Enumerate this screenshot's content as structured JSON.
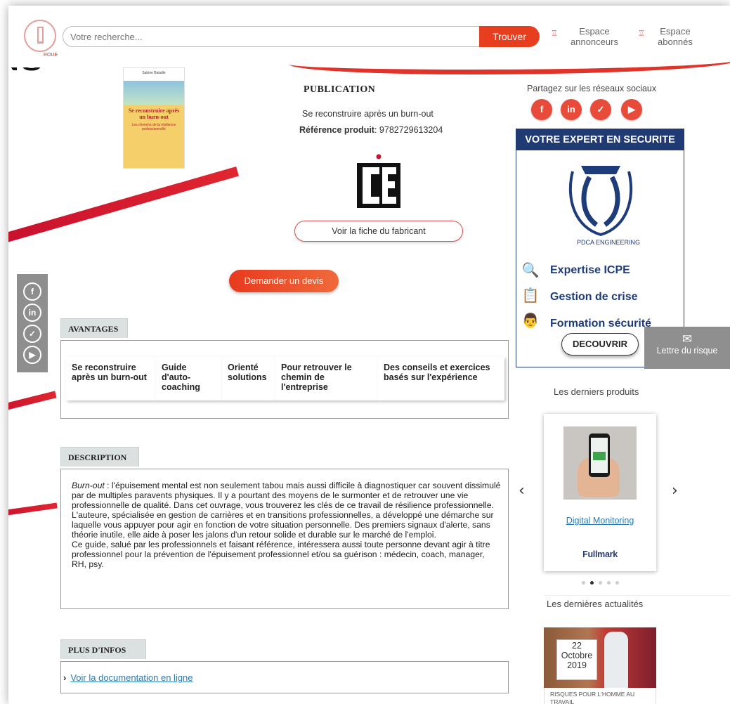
{
  "header": {
    "search_placeholder": "Votre recherche...",
    "search_button": "Trouver",
    "annonceurs_line1": "Espace",
    "annonceurs_line2": "annonceurs",
    "abonnes_line1": "Espace",
    "abonnes_line2": "abonnés",
    "logo_text": "ROUE",
    "background_text": "NS"
  },
  "publication": {
    "section_title": "PUBLICATION",
    "name": "Se reconstruire après un burn-out",
    "ref_label": "Référence produit",
    "ref_value": ": 9782729613204",
    "fiche_button": "Voir la fiche du fabricant",
    "devis_button": "Demander un devis",
    "book": {
      "author": "Sabine Bataille",
      "title": "Se reconstruire après un burn-out",
      "subtitle": "Les chemins de la résilience professionnelle"
    }
  },
  "avantages": {
    "label": "AVANTAGES",
    "items": [
      "Se reconstruire après un burn-out",
      "Guide d'auto-coaching",
      "Orienté solutions",
      "Pour retrouver le chemin de l'entreprise",
      "Des conseils et exercices basés sur l'expérience"
    ]
  },
  "description": {
    "label": "DESCRIPTION",
    "para1_em": "Burn-out",
    "para1": " : l'épuisement mental est non seulement tabou mais aussi difficile à diagnostiquer car souvent dissimulé par de multiples paravents physiques. Il y a pourtant des moyens de le surmonter et de retrouver une vie professionnelle de qualité. Dans cet ouvrage, vous trouverez les clés de ce travail de résilience professionnelle.",
    "para2": "L'auteure, spécialisée en gestion de carrières et en transitions professionnelles, a développé une démarche sur laquelle vous appuyer pour agir en fonction de votre situation personnelle. Des premiers signaux d'alerte, sans théorie inutile, elle aide à poser les jalons d'un retour solide et durable sur le marché de l'emploi.",
    "para3": "Ce guide, salué par les professionnels et faisant référence, intéressera aussi toute personne devant agir à titre professionnel pour la prévention de l'épuisement professionnel et/ou sa guérison : médecin, coach, manager, RH, psy."
  },
  "plus_infos": {
    "label": "PLUS D'INFOS",
    "link": "Voir la documentation en ligne"
  },
  "share": {
    "title": "Partagez sur les réseaux sociaux",
    "icons": [
      "facebook-icon",
      "linkedin-icon",
      "twitter-icon",
      "youtube-icon"
    ]
  },
  "ad": {
    "header": "VOTRE EXPERT EN SECURITE",
    "logo_text": "PDCA ENGINEERING",
    "items": [
      "Expertise ICPE",
      "Gestion de crise",
      "Formation sécurité"
    ],
    "button": "DECOUVRIR"
  },
  "newsletter": {
    "label": "Lettre du risque"
  },
  "products": {
    "title": "Les derniers produits",
    "items": [
      {
        "name": "Digital Monitoring",
        "brand": "Fullmark"
      }
    ],
    "dots": 5,
    "active_dot": 1
  },
  "news": {
    "title": "Les dernières actualités",
    "day": "22",
    "month": "Octobre",
    "year": "2019",
    "caption": "RISQUES POUR L'HOMME AU TRAVAIL"
  },
  "colors": {
    "accent": "#e83e20",
    "ad_navy": "#203b73",
    "link": "#2a7ab0"
  }
}
